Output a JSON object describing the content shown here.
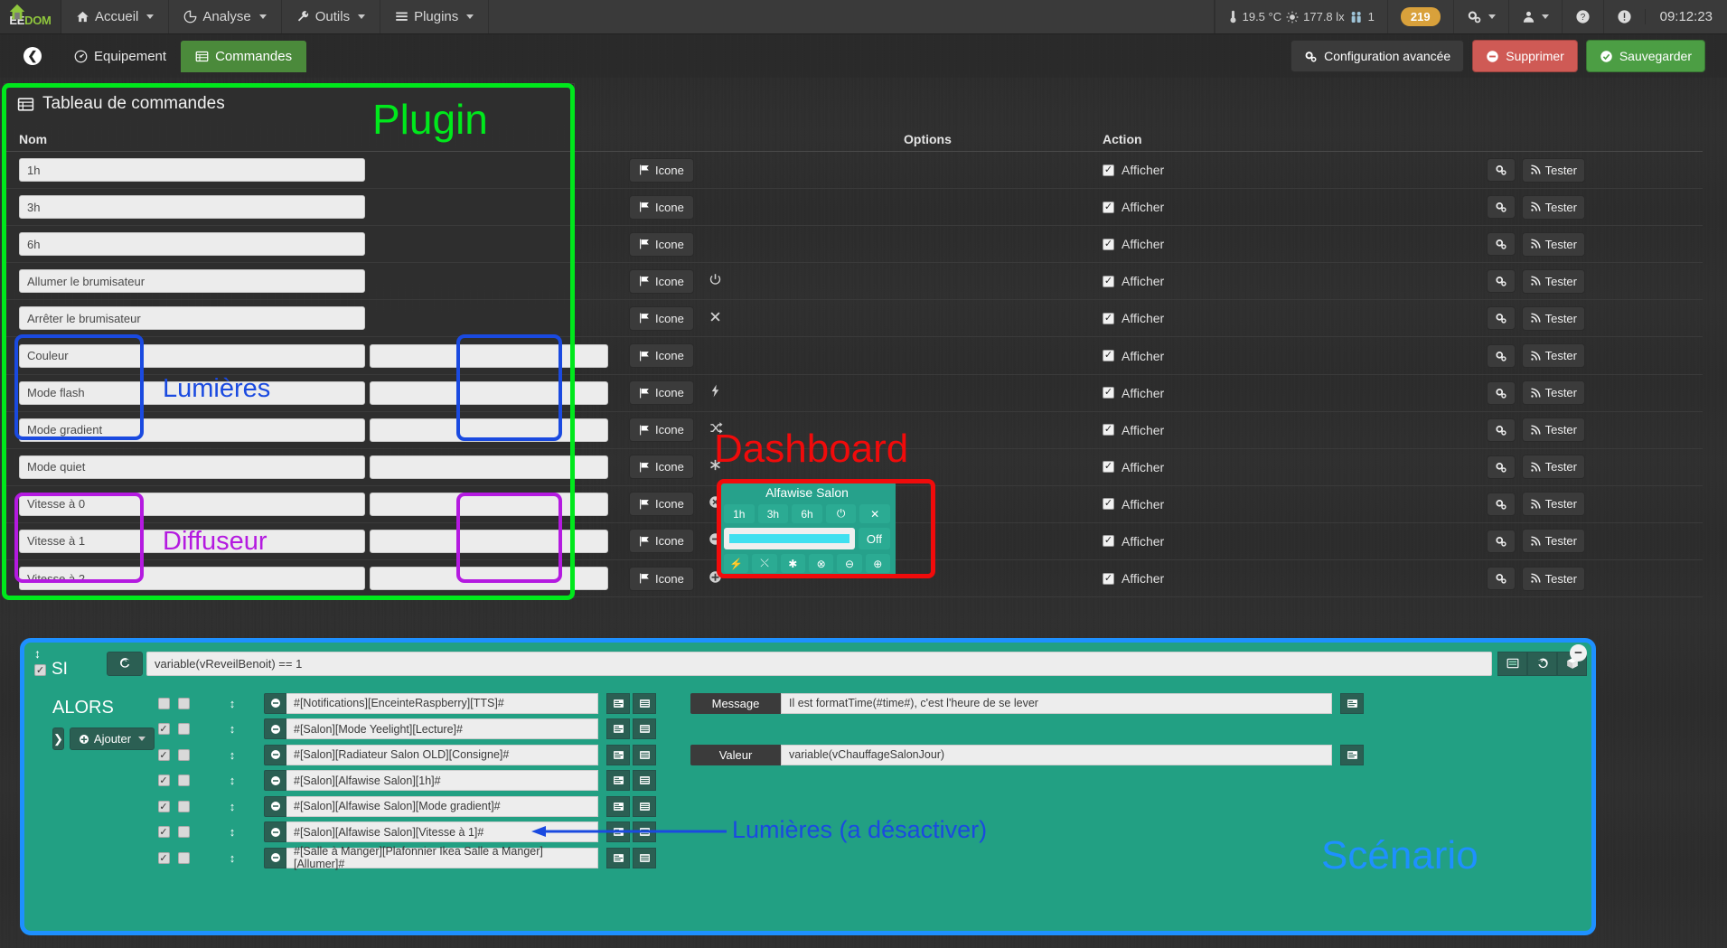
{
  "navbar": {
    "logo_white": "EE",
    "logo_green": "DOM",
    "menu": [
      {
        "label": "Accueil",
        "icon": "home-icon"
      },
      {
        "label": "Analyse",
        "icon": "chart-icon"
      },
      {
        "label": "Outils",
        "icon": "wrench-icon"
      },
      {
        "label": "Plugins",
        "icon": "list-icon"
      }
    ],
    "stats": {
      "temperature": "19.5 °C",
      "luminosity": "177.8 lx",
      "people": "1"
    },
    "badge": "219",
    "clock": "09:12:23"
  },
  "tabs": {
    "back_label": "❮",
    "items": [
      {
        "label": "Equipement",
        "icon": "dashboard-icon",
        "active": false
      },
      {
        "label": "Commandes",
        "icon": "table-icon",
        "active": true
      }
    ],
    "actions": [
      {
        "label": "Configuration avancée",
        "icon": "gears-icon",
        "style": "dark"
      },
      {
        "label": "Supprimer",
        "icon": "minus-circle-icon",
        "style": "red"
      },
      {
        "label": "Sauvegarder",
        "icon": "check-circle-icon",
        "style": "green"
      }
    ]
  },
  "panel": {
    "title": "Tableau de commandes",
    "icon": "table-icon"
  },
  "table": {
    "headers": {
      "nom": "Nom",
      "options": "Options",
      "action": "Action"
    },
    "icone_label": "Icone",
    "afficher_label": "Afficher",
    "tester_label": "Tester",
    "rows": [
      {
        "name": "1h",
        "second_input": false,
        "icon": "",
        "checked": true
      },
      {
        "name": "3h",
        "second_input": false,
        "icon": "",
        "checked": true
      },
      {
        "name": "6h",
        "second_input": false,
        "icon": "",
        "checked": true
      },
      {
        "name": "Allumer le brumisateur",
        "second_input": false,
        "icon": "power-icon",
        "checked": true
      },
      {
        "name": "Arrêter le brumisateur",
        "second_input": false,
        "icon": "close-icon",
        "checked": true
      },
      {
        "name": "Couleur",
        "second_input": true,
        "icon": "",
        "checked": true
      },
      {
        "name": "Mode flash",
        "second_input": true,
        "icon": "bolt-icon",
        "checked": true
      },
      {
        "name": "Mode gradient",
        "second_input": true,
        "icon": "shuffle-icon",
        "checked": true
      },
      {
        "name": "Mode quiet",
        "second_input": true,
        "icon": "asterisk-icon",
        "checked": true
      },
      {
        "name": "Vitesse à 0",
        "second_input": true,
        "icon": "times-circle-icon",
        "checked": true
      },
      {
        "name": "Vitesse à 1",
        "second_input": true,
        "icon": "minus-circle-icon",
        "checked": true
      },
      {
        "name": "Vitesse à 2",
        "second_input": true,
        "icon": "plus-circle-icon",
        "checked": true
      }
    ]
  },
  "dashboard": {
    "title": "Alfawise Salon",
    "top_buttons": [
      "1h",
      "3h",
      "6h",
      "⏻",
      "✕"
    ],
    "off_label": "Off",
    "color_value": "#3fe0f0",
    "bottom_buttons": [
      "⚡",
      "⤬",
      "✱",
      "⊗",
      "⊖",
      "⊕"
    ]
  },
  "scenario": {
    "si_label": "SI",
    "condition": "variable(vReveilBenoit) == 1",
    "alors_label": "ALORS",
    "ajouter_label": "Ajouter",
    "refresh_icon": "refresh-icon",
    "top_icons": [
      "list-icon",
      "history-icon",
      "box-icon"
    ],
    "collapse_icon": "minus-circle-icon",
    "actions": [
      {
        "text": "#[Notifications][EnceinteRaspberry][TTS]#",
        "checked": false
      },
      {
        "text": "#[Salon][Mode Yeelight][Lecture]#",
        "checked": true
      },
      {
        "text": "#[Salon][Radiateur Salon OLD][Consigne]#",
        "checked": true
      },
      {
        "text": "#[Salon][Alfawise Salon][1h]#",
        "checked": true
      },
      {
        "text": "#[Salon][Alfawise Salon][Mode gradient]#",
        "checked": true
      },
      {
        "text": "#[Salon][Alfawise Salon][Vitesse à 1]#",
        "checked": true
      },
      {
        "text": "#[Salle à Manger][Plafonnier Ikea Salle a Manger][Allumer]#",
        "checked": true
      }
    ],
    "params": [
      {
        "label": "Message",
        "value": "Il est formatTime(#time#),  c'est l'heure de se lever"
      },
      {
        "label": "Valeur",
        "value": "variable(vChauffageSalonJour)"
      }
    ]
  },
  "annotations": {
    "plugin": "Plugin",
    "lumieres": "Lumières",
    "diffuseur": "Diffuseur",
    "dashboard": "Dashboard",
    "scenario": "Scénario",
    "lumieres_desactiver": "Lumières (a désactiver)",
    "colors": {
      "plugin": "#00e81c",
      "lumieres": "#1a4ae0",
      "diffuseur": "#b41ae0",
      "dashboard": "#f00b0b",
      "scenario": "#1e90ff"
    }
  }
}
